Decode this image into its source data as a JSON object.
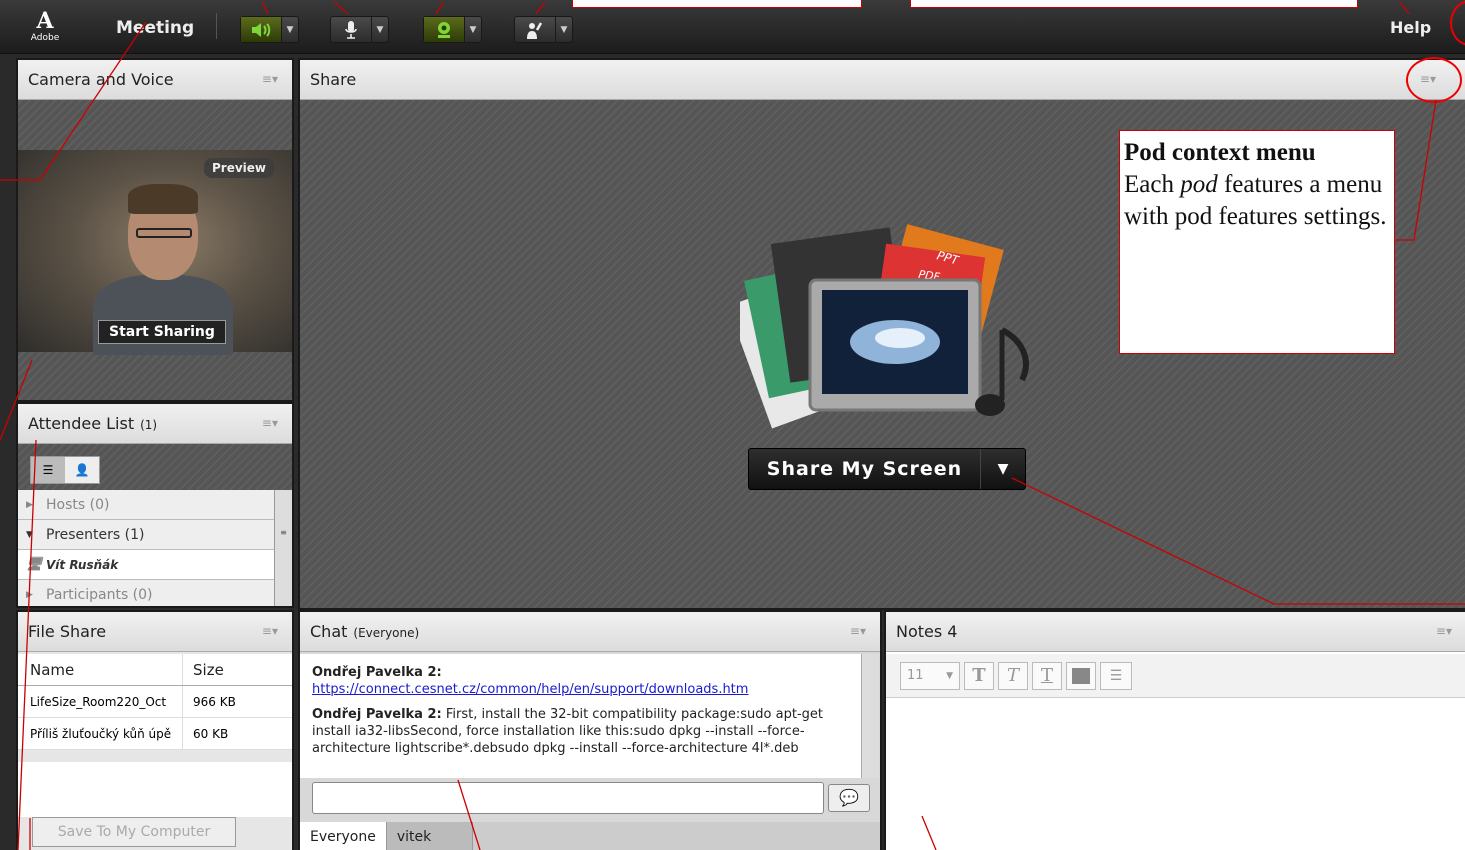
{
  "topbar": {
    "logo_letter": "A",
    "logo_word": "Adobe",
    "meeting_label": "Meeting",
    "help_label": "Help"
  },
  "camera_pod": {
    "title": "Camera and Voice",
    "preview_label": "Preview",
    "start_sharing_label": "Start Sharing"
  },
  "attendee_pod": {
    "title": "Attendee List",
    "count": "(1)",
    "rows": {
      "hosts": "Hosts (0)",
      "presenters": "Presenters (1)",
      "presenter_name": "Vít Rusňák",
      "participants": "Participants (0)"
    }
  },
  "share_pod": {
    "title": "Share",
    "share_button_label": "Share My Screen",
    "graphic_labels": [
      "PPT",
      "PDF"
    ]
  },
  "file_pod": {
    "title": "File Share",
    "columns": [
      "Name",
      "Size"
    ],
    "files": [
      {
        "name": "LifeSize_Room220_Oct",
        "size": "966 KB"
      },
      {
        "name": "Příliš žluťoučký kůň úpě",
        "size": "60 KB"
      }
    ],
    "save_label": "Save To My Computer"
  },
  "chat_pod": {
    "title": "Chat",
    "scope": "(Everyone)",
    "messages": {
      "m1_author": "Ondřej Pavelka 2:",
      "m1_link": "https://connect.cesnet.cz/common/help/en/support/downloads.htm",
      "m2_author": "Ondřej Pavelka 2:",
      "m2_text": " First, install the 32-bit compatibility package:sudo apt-get install ia32-libsSecond, force installation like this:sudo dpkg --install --force-architecture lightscribe*.debsudo dpkg --install --force-architecture 4l*.deb"
    },
    "tabs": [
      "Everyone",
      "vitek"
    ]
  },
  "notes_pod": {
    "title": "Notes 4",
    "font_size": "11"
  },
  "annotation": {
    "title": "Pod context menu",
    "text_pre": "Each ",
    "text_italic": "pod",
    "text_post": " features a menu with pod features settings."
  },
  "colors": {
    "accent_green": "#5d6b1c",
    "annotation_red": "#cc0000",
    "link_blue": "#1a1ad0"
  }
}
